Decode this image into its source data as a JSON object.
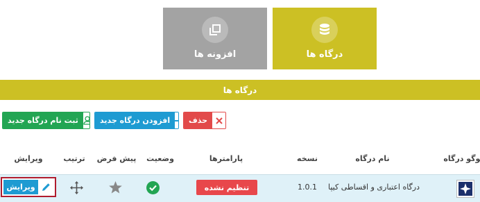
{
  "tiles": {
    "gateways": {
      "label": "درگاه ها",
      "icon": "database-icon"
    },
    "plugins": {
      "label": "افزونه ها",
      "icon": "copy-icon"
    }
  },
  "section": {
    "title": "درگاه ها"
  },
  "toolbar": {
    "delete_label": "حذف",
    "add_label": "افزودن درگاه جدید",
    "register_label": "ثبت نام درگاه جدید"
  },
  "table": {
    "headers": {
      "logo": "لوگو درگاه",
      "name": "نام درگاه",
      "version": "نسخه",
      "params": "پارامترها",
      "status": "وضعیت",
      "default": "پیش فرض",
      "order": "ترتیب",
      "edit": "ویرایش"
    },
    "rows": [
      {
        "name": "درگاه اعتباری و اقساطی کیپا",
        "version": "1.0.1",
        "params_label": "تنظیم نشده",
        "status": "active",
        "edit_label": "ویرایش"
      }
    ]
  },
  "colors": {
    "accent": "#ccc024",
    "tile_inactive": "#a3a3a3",
    "danger": "#e24a4a",
    "primary": "#1e9bd2",
    "success": "#22a553",
    "row_bg": "#dff1f8"
  }
}
